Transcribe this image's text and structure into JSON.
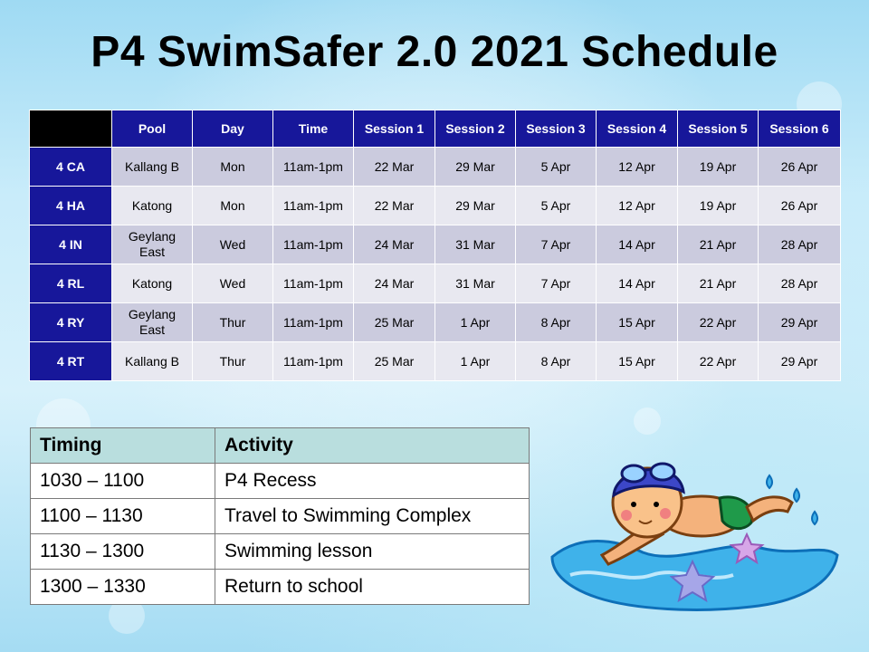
{
  "title": "P4 SwimSafer 2.0 2021 Schedule",
  "schedule": {
    "headers": [
      "",
      "Pool",
      "Day",
      "Time",
      "Session 1",
      "Session 2",
      "Session 3",
      "Session 4",
      "Session 5",
      "Session 6"
    ],
    "rows": [
      {
        "class": "4 CA",
        "pool": "Kallang B",
        "day": "Mon",
        "time": "11am-1pm",
        "sessions": [
          "22 Mar",
          "29 Mar",
          "5 Apr",
          "12 Apr",
          "19 Apr",
          "26 Apr"
        ]
      },
      {
        "class": "4 HA",
        "pool": "Katong",
        "day": "Mon",
        "time": "11am-1pm",
        "sessions": [
          "22 Mar",
          "29 Mar",
          "5 Apr",
          "12 Apr",
          "19 Apr",
          "26 Apr"
        ]
      },
      {
        "class": "4 IN",
        "pool": "Geylang East",
        "day": "Wed",
        "time": "11am-1pm",
        "sessions": [
          "24 Mar",
          "31 Mar",
          "7 Apr",
          "14 Apr",
          "21 Apr",
          "28 Apr"
        ]
      },
      {
        "class": "4 RL",
        "pool": "Katong",
        "day": "Wed",
        "time": "11am-1pm",
        "sessions": [
          "24 Mar",
          "31 Mar",
          "7 Apr",
          "14 Apr",
          "21 Apr",
          "28 Apr"
        ]
      },
      {
        "class": "4 RY",
        "pool": "Geylang East",
        "day": "Thur",
        "time": "11am-1pm",
        "sessions": [
          "25 Mar",
          "1 Apr",
          "8 Apr",
          "15 Apr",
          "22 Apr",
          "29 Apr"
        ]
      },
      {
        "class": "4 RT",
        "pool": "Kallang B",
        "day": "Thur",
        "time": "11am-1pm",
        "sessions": [
          "25 Mar",
          "1 Apr",
          "8 Apr",
          "15 Apr",
          "22 Apr",
          "29 Apr"
        ]
      }
    ]
  },
  "timing": {
    "headers": [
      "Timing",
      "Activity"
    ],
    "rows": [
      {
        "timing": "1030 – 1100",
        "activity": "P4 Recess"
      },
      {
        "timing": "1100 – 1130",
        "activity": "Travel to Swimming Complex"
      },
      {
        "timing": "1130 – 1300",
        "activity": "Swimming lesson"
      },
      {
        "timing": "1300 – 1330",
        "activity": "Return to school"
      }
    ]
  },
  "colors": {
    "header_navy": "#17179a",
    "row_odd": "#cbcbde",
    "row_even": "#e8e8f0",
    "timing_header": "#b9dede",
    "background": "#c9ecfa"
  },
  "illustration": "swimming-child-clipart"
}
